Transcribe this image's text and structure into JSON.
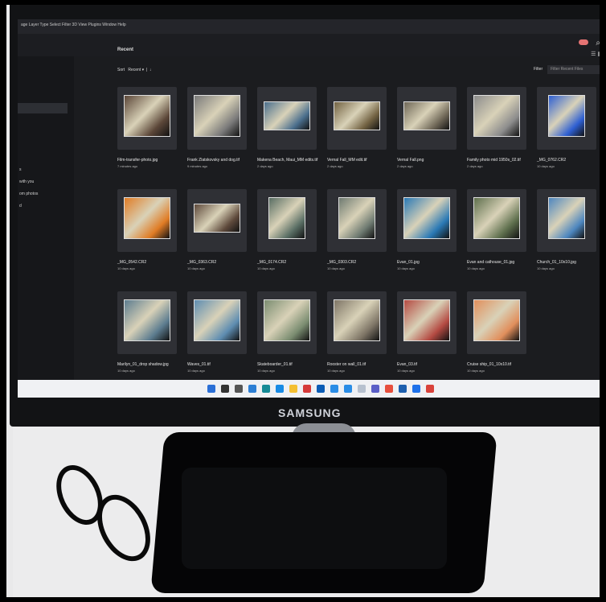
{
  "screen": {
    "menu": "age Layer Type Select Filter 3D View Plugins Window Help",
    "section_title": "Recent",
    "sort_label": "Sort",
    "sort_value": "Recent",
    "filter_label": "Filter",
    "filter_placeholder": "Filter Recent Files",
    "sidebar": [
      "s",
      "with you",
      "om photos",
      "d"
    ],
    "files": [
      {
        "name": "Film-transfer-photo.jpg",
        "date": "7 minutes ago",
        "color": "#5b4638"
      },
      {
        "name": "Frank Zlatskovsky and dog.tif",
        "date": "9 minutes ago",
        "color": "#7a7a7a"
      },
      {
        "name": "Makena Beach, Maui_MM edits.tif",
        "date": "2 days ago",
        "color": "#4b6f8d"
      },
      {
        "name": "Vernal Fall_MM edit.tif",
        "date": "2 days ago",
        "color": "#726242"
      },
      {
        "name": "Vernal Fall.png",
        "date": "2 days ago",
        "color": "#6f6757"
      },
      {
        "name": "Family photo mid 1950s_02.tif",
        "date": "2 days ago",
        "color": "#8c8c8c"
      },
      {
        "name": "_MG_0762.CR2",
        "date": "10 days ago",
        "color": "#2e5fd2"
      },
      {
        "name": "_MG_0542.CR2",
        "date": "10 days ago",
        "color": "#e07c25"
      },
      {
        "name": "_MG_0363.CR2",
        "date": "10 days ago",
        "color": "#5f4a3c"
      },
      {
        "name": "_MG_0174.CR2",
        "date": "10 days ago",
        "color": "#586d63"
      },
      {
        "name": "_MG_0303.CR2",
        "date": "10 days ago",
        "color": "#6e7a71"
      },
      {
        "name": "Evan_01.jpg",
        "date": "10 days ago",
        "color": "#2a79b5"
      },
      {
        "name": "Evan and cathouse_01.jpg",
        "date": "10 days ago",
        "color": "#5e6f4d"
      },
      {
        "name": "Church_01_10x10.jpg",
        "date": "10 days ago",
        "color": "#4d86bf"
      },
      {
        "name": "Marilyn_01_drop shadow.jpg",
        "date": "10 days ago",
        "color": "#5c7c8f"
      },
      {
        "name": "Waves_01.tif",
        "date": "10 days ago",
        "color": "#5e8db1"
      },
      {
        "name": "Skateboarder_01.tif",
        "date": "10 days ago",
        "color": "#7b8d71"
      },
      {
        "name": "Rooster on wall_01.tif",
        "date": "10 days ago",
        "color": "#7e7566"
      },
      {
        "name": "Evan_03.tif",
        "date": "10 days ago",
        "color": "#b44a42"
      },
      {
        "name": "Cruise ship_01_10x10.tif",
        "date": "10 days ago",
        "color": "#e18f5c"
      }
    ]
  },
  "monitor": {
    "brand": "SAMSUNG"
  },
  "colors": {
    "taskbar_icons": [
      "#2b6fd6",
      "#333",
      "#555",
      "#2d7fd4",
      "#168a96",
      "#198be5",
      "#f4bf32",
      "#d63a3a",
      "#0b5cb5",
      "#2b8de6",
      "#2b8de6",
      "#b7c1cf",
      "#5b5fc7",
      "#e74f3d",
      "#1d5fae",
      "#1e71ea",
      "#d9423b"
    ]
  }
}
